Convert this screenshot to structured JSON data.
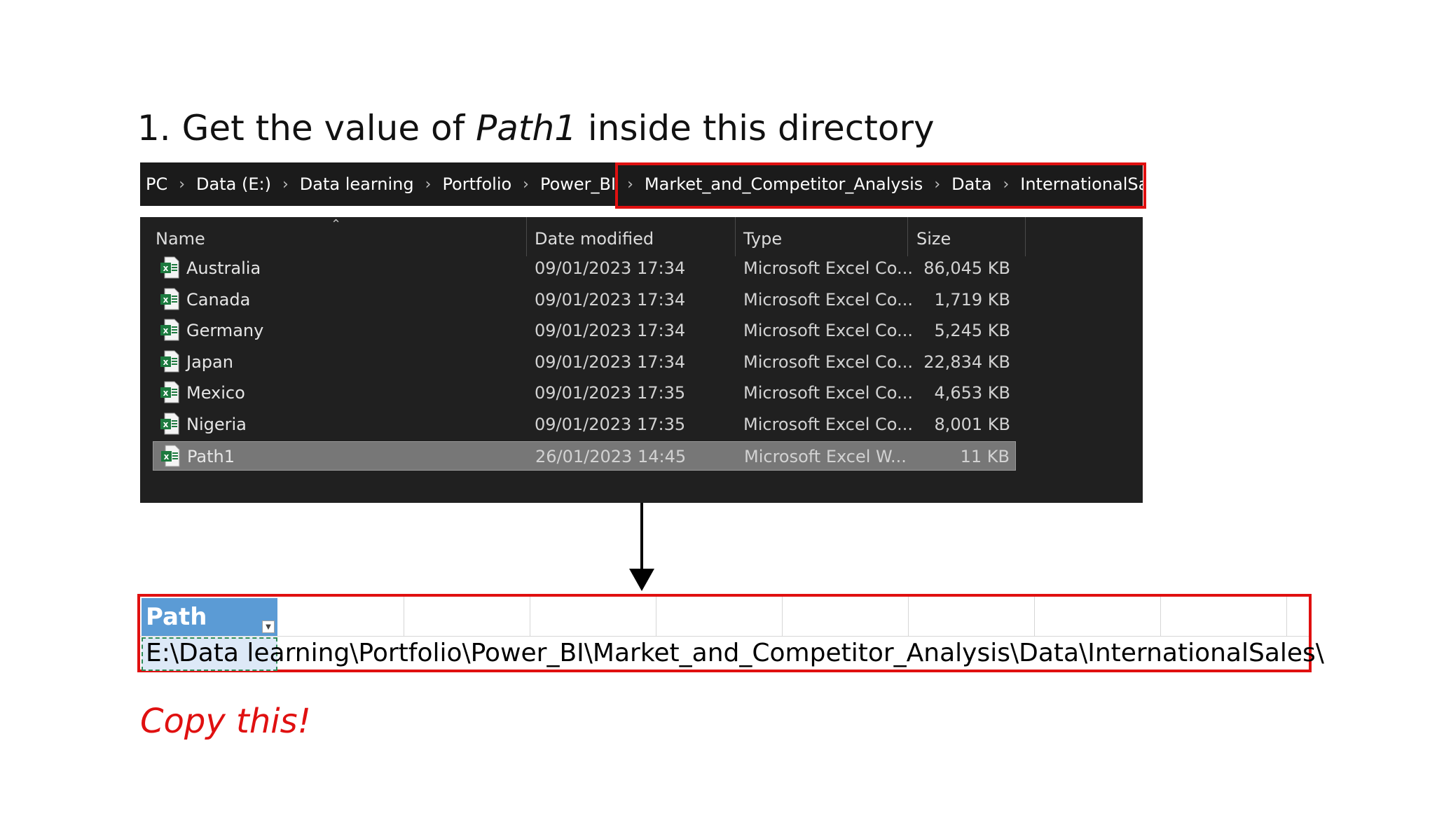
{
  "instruction": {
    "prefix": "1. Get the value of ",
    "emphasis": "Path1",
    "suffix": " inside this directory"
  },
  "breadcrumb": [
    "PC",
    "Data (E:)",
    "Data learning",
    "Portfolio",
    "Power_BI",
    "Market_and_Competitor_Analysis",
    "Data",
    "InternationalSales"
  ],
  "explorer": {
    "columns": {
      "name": "Name",
      "date": "Date modified",
      "type": "Type",
      "size": "Size"
    },
    "files": [
      {
        "name": "Australia",
        "date": "09/01/2023 17:34",
        "type": "Microsoft Excel Co...",
        "size": "86,045 KB",
        "icon": "excel-csv-icon",
        "selected": false
      },
      {
        "name": "Canada",
        "date": "09/01/2023 17:34",
        "type": "Microsoft Excel Co...",
        "size": "1,719 KB",
        "icon": "excel-csv-icon",
        "selected": false
      },
      {
        "name": "Germany",
        "date": "09/01/2023 17:34",
        "type": "Microsoft Excel Co...",
        "size": "5,245 KB",
        "icon": "excel-csv-icon",
        "selected": false
      },
      {
        "name": "Japan",
        "date": "09/01/2023 17:34",
        "type": "Microsoft Excel Co...",
        "size": "22,834 KB",
        "icon": "excel-csv-icon",
        "selected": false
      },
      {
        "name": "Mexico",
        "date": "09/01/2023 17:35",
        "type": "Microsoft Excel Co...",
        "size": "4,653 KB",
        "icon": "excel-csv-icon",
        "selected": false
      },
      {
        "name": "Nigeria",
        "date": "09/01/2023 17:35",
        "type": "Microsoft Excel Co...",
        "size": "8,001 KB",
        "icon": "excel-csv-icon",
        "selected": false
      },
      {
        "name": "Path1",
        "date": "26/01/2023 14:45",
        "type": "Microsoft Excel W...",
        "size": "11 KB",
        "icon": "excel-workbook-icon",
        "selected": true
      }
    ]
  },
  "excel": {
    "header": "Path",
    "value": "E:\\Data learning\\Portfolio\\Power_BI\\Market_and_Competitor_Analysis\\Data\\InternationalSales\\"
  },
  "note": "Copy this!",
  "colors": {
    "highlight_red": "#e01010",
    "explorer_bg": "#202020",
    "excel_header_blue": "#5b9bd5",
    "selected_row": "#777777"
  }
}
